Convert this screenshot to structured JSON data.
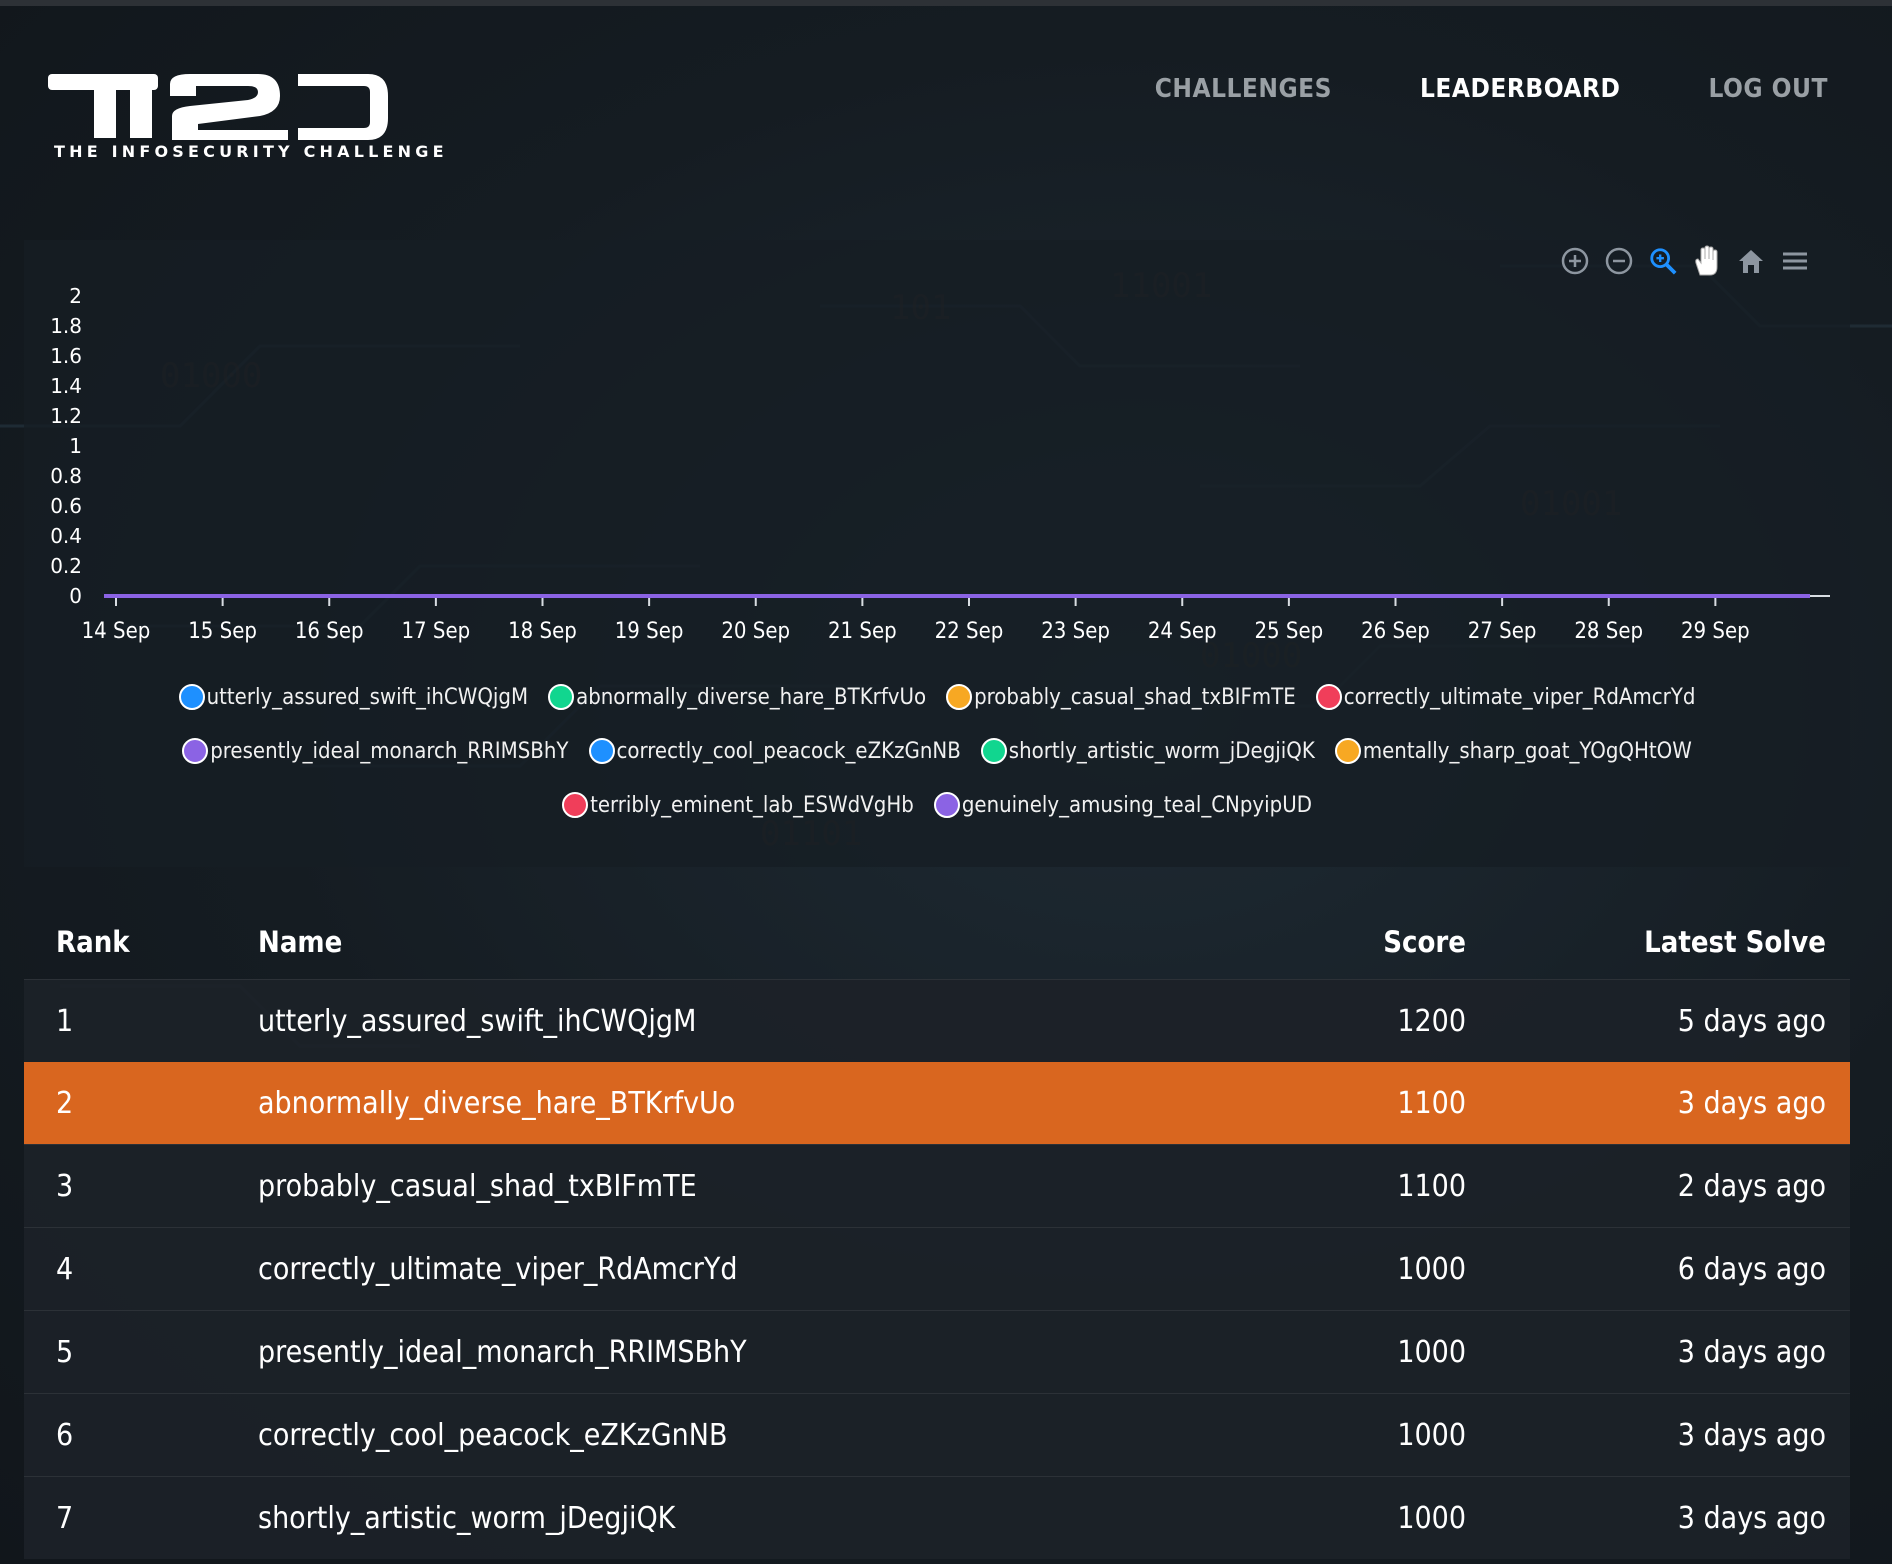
{
  "header": {
    "logo_text": "TI2D",
    "logo_subtitle": "THE INFOSECURITY CHALLENGE",
    "nav": [
      {
        "label": "CHALLENGES",
        "active": false
      },
      {
        "label": "LEADERBOARD",
        "active": true
      },
      {
        "label": "LOG OUT",
        "active": false
      }
    ]
  },
  "toolbar": {
    "icons": [
      "zoom-in-icon",
      "zoom-out-icon",
      "selection-zoom-icon",
      "pan-hand-icon",
      "home-reset-icon",
      "menu-icon"
    ]
  },
  "chart_data": {
    "type": "line",
    "x": [
      "14 Sep",
      "15 Sep",
      "16 Sep",
      "17 Sep",
      "18 Sep",
      "19 Sep",
      "20 Sep",
      "21 Sep",
      "22 Sep",
      "23 Sep",
      "24 Sep",
      "25 Sep",
      "26 Sep",
      "27 Sep",
      "28 Sep",
      "29 Sep"
    ],
    "y_ticks": [
      "2",
      "1.8",
      "1.6",
      "1.4",
      "1.2",
      "1",
      "0.8",
      "0.6",
      "0.4",
      "0.2",
      "0"
    ],
    "ylim": [
      0,
      2
    ],
    "series": [
      {
        "name": "utterly_assured_swift_ihCWQjgM",
        "color": "#1e90ff",
        "values": [
          0,
          0,
          0,
          0,
          0,
          0,
          0,
          0,
          0,
          0,
          0,
          0,
          0,
          0,
          0,
          0
        ]
      },
      {
        "name": "abnormally_diverse_hare_BTKrfvUo",
        "color": "#11d68f",
        "values": [
          0,
          0,
          0,
          0,
          0,
          0,
          0,
          0,
          0,
          0,
          0,
          0,
          0,
          0,
          0,
          0
        ]
      },
      {
        "name": "probably_casual_shad_txBIFmTE",
        "color": "#f7a823",
        "values": [
          0,
          0,
          0,
          0,
          0,
          0,
          0,
          0,
          0,
          0,
          0,
          0,
          0,
          0,
          0,
          0
        ]
      },
      {
        "name": "correctly_ultimate_viper_RdAmcrYd",
        "color": "#f03e5a",
        "values": [
          0,
          0,
          0,
          0,
          0,
          0,
          0,
          0,
          0,
          0,
          0,
          0,
          0,
          0,
          0,
          0
        ]
      },
      {
        "name": "presently_ideal_monarch_RRIMSBhY",
        "color": "#8b63e4",
        "values": [
          0,
          0,
          0,
          0,
          0,
          0,
          0,
          0,
          0,
          0,
          0,
          0,
          0,
          0,
          0,
          0
        ]
      },
      {
        "name": "correctly_cool_peacock_eZKzGnNB",
        "color": "#1e90ff",
        "values": [
          0,
          0,
          0,
          0,
          0,
          0,
          0,
          0,
          0,
          0,
          0,
          0,
          0,
          0,
          0,
          0
        ]
      },
      {
        "name": "shortly_artistic_worm_jDegjiQK",
        "color": "#11d68f",
        "values": [
          0,
          0,
          0,
          0,
          0,
          0,
          0,
          0,
          0,
          0,
          0,
          0,
          0,
          0,
          0,
          0
        ]
      },
      {
        "name": "mentally_sharp_goat_YOgQHtOW",
        "color": "#f7a823",
        "values": [
          0,
          0,
          0,
          0,
          0,
          0,
          0,
          0,
          0,
          0,
          0,
          0,
          0,
          0,
          0,
          0
        ]
      },
      {
        "name": "terribly_eminent_lab_ESWdVgHb",
        "color": "#f03e5a",
        "values": [
          0,
          0,
          0,
          0,
          0,
          0,
          0,
          0,
          0,
          0,
          0,
          0,
          0,
          0,
          0,
          0
        ]
      },
      {
        "name": "genuinely_amusing_teal_CNpyipUD",
        "color": "#8b63e4",
        "values": [
          0,
          0,
          0,
          0,
          0,
          0,
          0,
          0,
          0,
          0,
          0,
          0,
          0,
          0,
          0,
          0
        ]
      }
    ],
    "legend": "bottom"
  },
  "table": {
    "headers": {
      "rank": "Rank",
      "name": "Name",
      "score": "Score",
      "latest": "Latest Solve"
    },
    "rows": [
      {
        "rank": "1",
        "name": "utterly_assured_swift_ihCWQjgM",
        "score": "1200",
        "latest": "5 days ago",
        "highlight": false
      },
      {
        "rank": "2",
        "name": "abnormally_diverse_hare_BTKrfvUo",
        "score": "1100",
        "latest": "3 days ago",
        "highlight": true
      },
      {
        "rank": "3",
        "name": "probably_casual_shad_txBIFmTE",
        "score": "1100",
        "latest": "2 days ago",
        "highlight": false
      },
      {
        "rank": "4",
        "name": "correctly_ultimate_viper_RdAmcrYd",
        "score": "1000",
        "latest": "6 days ago",
        "highlight": false
      },
      {
        "rank": "5",
        "name": "presently_ideal_monarch_RRIMSBhY",
        "score": "1000",
        "latest": "3 days ago",
        "highlight": false
      },
      {
        "rank": "6",
        "name": "correctly_cool_peacock_eZKzGnNB",
        "score": "1000",
        "latest": "3 days ago",
        "highlight": false
      },
      {
        "rank": "7",
        "name": "shortly_artistic_worm_jDegjiQK",
        "score": "1000",
        "latest": "3 days ago",
        "highlight": false
      }
    ],
    "highlight_color": "#d9661f"
  }
}
